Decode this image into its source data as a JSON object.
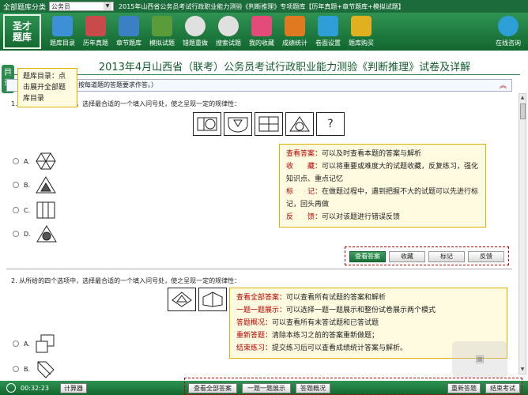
{
  "topbar": {
    "category_label": "全部题库分类",
    "category_value": "公务员",
    "title": "2015年山西省公务员考试行政职业能力测验《判断推理》专项题库【历年真题+章节题库+模拟试题】"
  },
  "toolbar": {
    "logo_line1": "圣才",
    "logo_line2": "题库",
    "buttons": [
      {
        "label": "题库目录",
        "icon": "monitor-icon",
        "color": "#3d8fd6"
      },
      {
        "label": "历年真题",
        "icon": "document-icon",
        "color": "#c94a4a"
      },
      {
        "label": "章节题库",
        "icon": "book-icon",
        "color": "#3b7fc4"
      },
      {
        "label": "模拟试题",
        "icon": "pencil-icon",
        "color": "#5a9c3a"
      },
      {
        "label": "错题重做",
        "icon": "back-arrow-icon",
        "color": "#e0e0e0"
      },
      {
        "label": "搜索试题",
        "icon": "search-icon",
        "color": "#e0e0e0"
      },
      {
        "label": "我的收藏",
        "icon": "heart-icon",
        "color": "#e24b7a"
      },
      {
        "label": "成绩统计",
        "icon": "chart-icon",
        "color": "#e07a20"
      },
      {
        "label": "卷面设置",
        "icon": "settings-icon",
        "color": "#2d9fd6"
      },
      {
        "label": "题库购买",
        "icon": "cart-icon",
        "color": "#e0b020"
      }
    ],
    "online_label": "在线咨询"
  },
  "side_tab": "目录",
  "main_title": "2013年4月山西省（联考）公务员考试行政职业能力测验《判断推理》试卷及详解",
  "section_bar": "按每道题的答题要求作答。）",
  "question1": {
    "text": "1. 从所给的四个选项中，选择最合适的一个填入问号处，使之呈现一定的规律性：",
    "question_mark": "?",
    "options": [
      "A.",
      "B.",
      "C.",
      "D."
    ]
  },
  "answer_buttons": {
    "view": "查看答案",
    "favorite": "收藏",
    "mark": "标记",
    "feedback": "反馈"
  },
  "question2": {
    "text": "2. 从所给的四个选项中，选择最合适的一个填入问号处，使之呈现一定的规律性：",
    "options": [
      "A.",
      "B."
    ]
  },
  "tip_catalog": "题库目录：点击展开全部题库目录",
  "tip_answer": [
    {
      "k": "查看答案：",
      "v": "可以及时查看本题的答案与解析"
    },
    {
      "k": "收　　藏：",
      "v": "可以将重要或难度大的试题收藏，反复练习，强化知识点、重点记忆"
    },
    {
      "k": "标　　记：",
      "v": "在做题过程中，遇到把握不大的试题可以先进行标记，回头再做"
    },
    {
      "k": "反　　馈：",
      "v": "可以对该题进行错误反馈"
    }
  ],
  "tip_bottom": [
    {
      "k": "查看全部答案：",
      "v": "可以查看所有试题的答案和解析"
    },
    {
      "k": "一题一题展示：",
      "v": "可以选择一题一题展示和整份试卷展示两个模式"
    },
    {
      "k": "答题概况：",
      "v": "可以查看所有未答试题和已答试题"
    },
    {
      "k": "重新答题：",
      "v": "清除本练习之前的答案重新做题；"
    },
    {
      "k": "结束练习：",
      "v": "提交练习后可以查看成绩统计答案与解析。"
    }
  ],
  "bottombar": {
    "time": "00:32:23",
    "calculator": "计算器",
    "view_all": "查看全部答案",
    "one_by_one": "一题一题展示",
    "overview": "答题概况",
    "restart": "重新答题",
    "finish": "结束考试"
  }
}
